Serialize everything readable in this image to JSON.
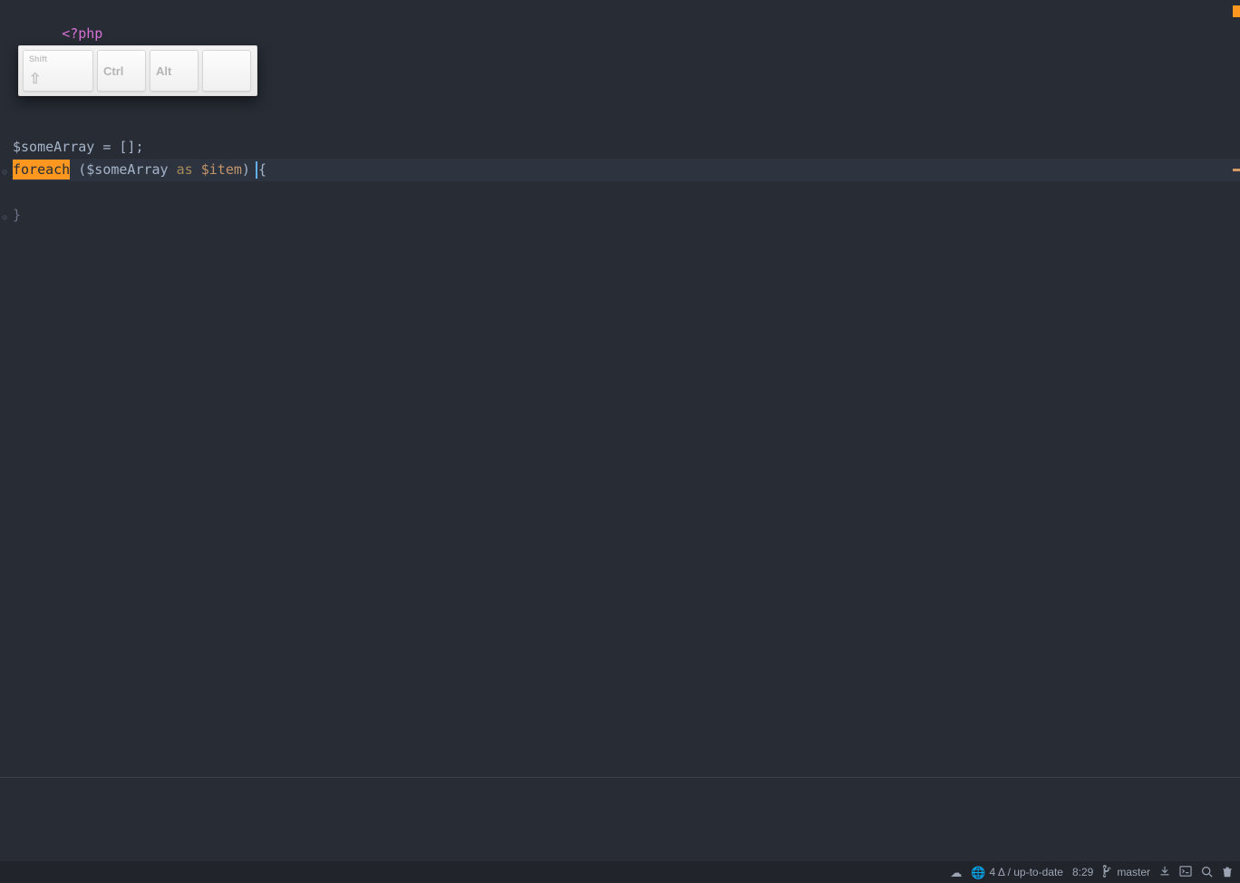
{
  "code": {
    "line1": {
      "php_open": "<?php"
    },
    "line7": {
      "var": "$someArray",
      "assign": " = []",
      "semi": ";"
    },
    "line8": {
      "foreach": "foreach",
      "space1": " ",
      "open_paren": "(",
      "arr_var": "$someArray",
      "space2": " ",
      "as": "as",
      "space3": " ",
      "item_prefix": "$it",
      "item_suffix": "em",
      "close_paren": ")",
      "space4": " ",
      "open_brace": "{"
    },
    "line10": {
      "close_brace": "}"
    }
  },
  "keyboard": {
    "shift": "Shift",
    "ctrl": "Ctrl",
    "alt": "Alt",
    "shift_arrow": "⇧"
  },
  "status": {
    "cloud_icon": "☁",
    "globe_icon": "🌐",
    "delta": "4 Δ / up-to-date",
    "cursor_pos": "8:29",
    "branch_icon": "⎇",
    "branch": "master"
  }
}
